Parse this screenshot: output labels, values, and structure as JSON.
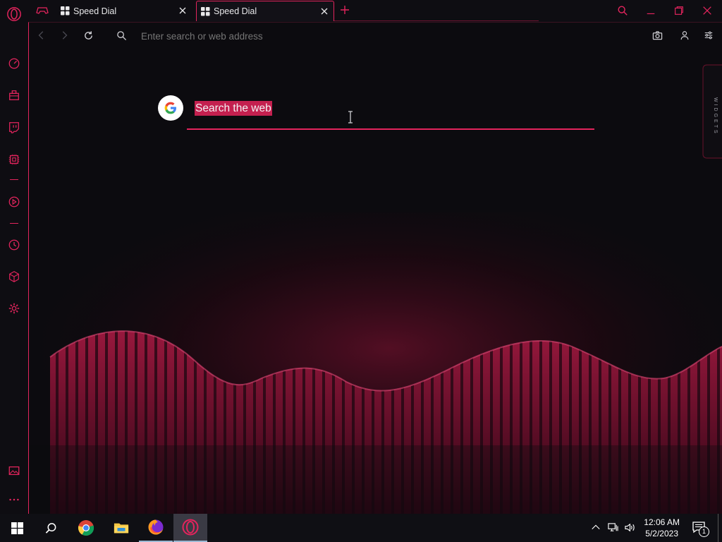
{
  "tabs": [
    {
      "label": "Speed Dial",
      "active": false
    },
    {
      "label": "Speed Dial",
      "active": true
    }
  ],
  "address_bar": {
    "placeholder": "Enter search or web address"
  },
  "search": {
    "text": "Search the web"
  },
  "widgets": {
    "label": "WIDGETS"
  },
  "taskbar": {
    "time": "12:06 AM",
    "date": "5/2/2023",
    "notification_count": "1"
  },
  "colors": {
    "accent": "#e3245d",
    "background": "#0b0a0e",
    "selection": "#c4204f"
  },
  "icons": {
    "sidebar": [
      "opera-logo-icon",
      "speed-dial-gauge-icon",
      "gx-corner-icon",
      "twitch-icon",
      "hardware-limiter-icon",
      "player-icon",
      "history-icon",
      "extensions-cube-icon",
      "settings-gear-icon",
      "wallpaper-icon",
      "more-dots-icon"
    ],
    "toolbar": [
      "back-icon",
      "forward-icon",
      "reload-icon",
      "search-icon",
      "snapshot-camera-icon",
      "account-icon",
      "easy-setup-icon"
    ],
    "window": [
      "search-tabs-icon",
      "minimize-icon",
      "restore-icon",
      "close-icon"
    ],
    "taskbar": [
      "windows-start-icon",
      "search-icon",
      "chrome-icon",
      "file-explorer-icon",
      "firefox-icon",
      "opera-gx-icon",
      "show-hidden-icon",
      "network-icon",
      "volume-icon",
      "notifications-icon"
    ]
  }
}
